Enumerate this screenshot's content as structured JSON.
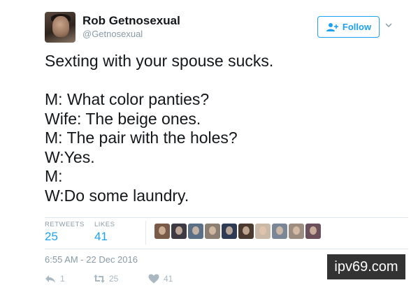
{
  "tweet": {
    "author": {
      "display_name": "Rob Getnosexual",
      "handle": "@Getnosexual"
    },
    "follow_label": "Follow",
    "text": "Sexting with your spouse sucks.\n\nM: What color panties?\nWife: The beige ones.\nM: The pair with the holes?\nW:Yes.\nM:\nW:Do some laundry.",
    "stats": {
      "retweets_label": "RETWEETS",
      "retweets_count": "25",
      "likes_label": "LIKES",
      "likes_count": "41"
    },
    "likers_count": 10,
    "timestamp": "6:55 AM - 22 Dec 2016",
    "actions": {
      "reply_count": "1",
      "retweet_count": "25",
      "like_count": "41"
    }
  },
  "watermark": "ipv69.com",
  "icons": {
    "follow": "add-user-icon",
    "more": "chevron-down-icon",
    "reply": "reply-icon",
    "retweet": "retweet-icon",
    "like": "heart-icon"
  },
  "colors": {
    "accent": "#1da1f2",
    "muted": "#8899a6",
    "action_gray": "#aab8c2",
    "text": "#14171a",
    "divider": "#e1e8ed",
    "watermark_bg": "#333333"
  }
}
